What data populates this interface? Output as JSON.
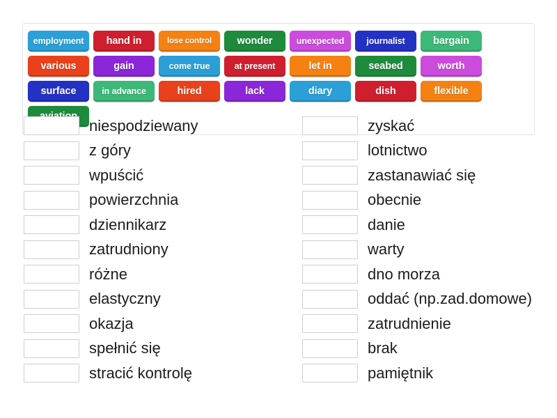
{
  "activity": {
    "type": "match-up",
    "language_pair": "English to Polish"
  },
  "tile_bank": {
    "name": "word-bank",
    "tiles": [
      {
        "label": "employment",
        "color": "#2a9fd8"
      },
      {
        "label": "hand in",
        "color": "#cf1f2e"
      },
      {
        "label": "lose control",
        "color": "#f58113"
      },
      {
        "label": "wonder",
        "color": "#1e8b3c"
      },
      {
        "label": "unexpected",
        "color": "#cb4bdc"
      },
      {
        "label": "journalist",
        "color": "#2331c4"
      },
      {
        "label": "bargain",
        "color": "#3cb878"
      },
      {
        "label": "various",
        "color": "#e8411b"
      },
      {
        "label": "gain",
        "color": "#8b26d9"
      },
      {
        "label": "come true",
        "color": "#2a9fd8"
      },
      {
        "label": "at present",
        "color": "#cf1f2e"
      },
      {
        "label": "let in",
        "color": "#f58113"
      },
      {
        "label": "seabed",
        "color": "#1e8b3c"
      },
      {
        "label": "worth",
        "color": "#cb4bdc"
      },
      {
        "label": "surface",
        "color": "#2331c4"
      },
      {
        "label": "in advance",
        "color": "#3cb878"
      },
      {
        "label": "hired",
        "color": "#e8411b"
      },
      {
        "label": "lack",
        "color": "#8b26d9"
      },
      {
        "label": "diary",
        "color": "#2a9fd8"
      },
      {
        "label": "dish",
        "color": "#cf1f2e"
      },
      {
        "label": "flexible",
        "color": "#f58113"
      },
      {
        "label": "aviation",
        "color": "#1e8b3c"
      }
    ]
  },
  "columns": {
    "left": [
      {
        "slot_value": "",
        "label": "niespodziewany"
      },
      {
        "slot_value": "",
        "label": "z góry"
      },
      {
        "slot_value": "",
        "label": "wpuścić"
      },
      {
        "slot_value": "",
        "label": "powierzchnia"
      },
      {
        "slot_value": "",
        "label": "dziennikarz"
      },
      {
        "slot_value": "",
        "label": "zatrudniony"
      },
      {
        "slot_value": "",
        "label": "różne"
      },
      {
        "slot_value": "",
        "label": "elastyczny"
      },
      {
        "slot_value": "",
        "label": "okazja"
      },
      {
        "slot_value": "",
        "label": "spełnić się"
      },
      {
        "slot_value": "",
        "label": "stracić kontrolę"
      }
    ],
    "right": [
      {
        "slot_value": "",
        "label": "zyskać"
      },
      {
        "slot_value": "",
        "label": "lotnictwo"
      },
      {
        "slot_value": "",
        "label": "zastanawiać się"
      },
      {
        "slot_value": "",
        "label": "obecnie"
      },
      {
        "slot_value": "",
        "label": "danie"
      },
      {
        "slot_value": "",
        "label": "warty"
      },
      {
        "slot_value": "",
        "label": "dno morza"
      },
      {
        "slot_value": "",
        "label": "oddać (np.zad.domowe)"
      },
      {
        "slot_value": "",
        "label": "zatrudnienie"
      },
      {
        "slot_value": "",
        "label": "brak"
      },
      {
        "slot_value": "",
        "label": "pamiętnik"
      }
    ]
  },
  "theme": {
    "page_background": "#ffffff",
    "bank_border": "#e2e2e2",
    "slot_border": "#cfcfcf",
    "text_color": "#1c1c1c"
  }
}
